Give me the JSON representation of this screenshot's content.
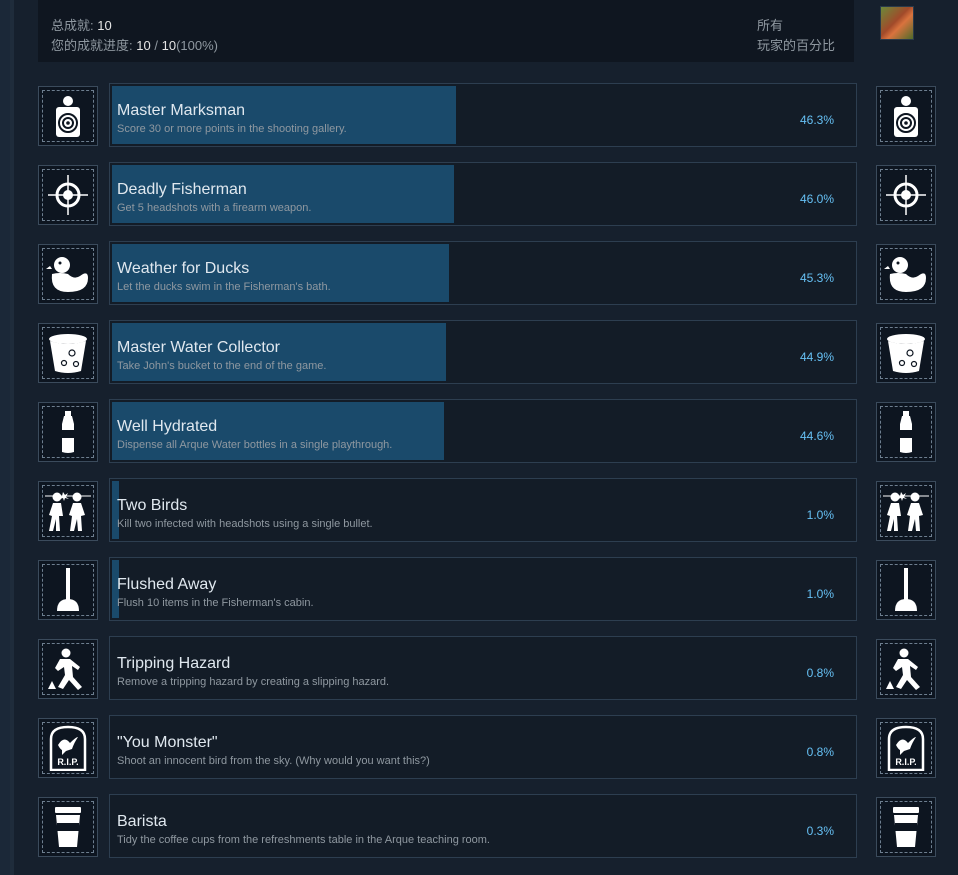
{
  "summary": {
    "total_label": "总成就:",
    "total_value": "10",
    "progress_label": "您的成就进度:",
    "progress_done": "10",
    "progress_sep": "/",
    "progress_total": "10",
    "progress_pct": "(100%)",
    "right_line1": "所有",
    "right_line2": "玩家的百分比"
  },
  "colors": {
    "bar": "#1a4a6b",
    "percent": "#66c0f4",
    "background": "#16202d"
  },
  "achievements": [
    {
      "title": "Master Marksman",
      "desc": "Score 30 or more points in the shooting gallery.",
      "percent": "46.3%",
      "fill": 0.463,
      "icon": "shooting-target-icon"
    },
    {
      "title": "Deadly Fisherman",
      "desc": "Get 5 headshots with a firearm weapon.",
      "percent": "46.0%",
      "fill": 0.46,
      "icon": "crosshair-icon"
    },
    {
      "title": "Weather for Ducks",
      "desc": "Let the ducks swim in the Fisherman's bath.",
      "percent": "45.3%",
      "fill": 0.453,
      "icon": "rubber-duck-icon"
    },
    {
      "title": "Master Water Collector",
      "desc": "Take John's bucket to the end of the game.",
      "percent": "44.9%",
      "fill": 0.449,
      "icon": "bucket-icon"
    },
    {
      "title": "Well Hydrated",
      "desc": "Dispense all Arque Water bottles in a single playthrough.",
      "percent": "44.6%",
      "fill": 0.446,
      "icon": "water-bottle-icon"
    },
    {
      "title": "Two Birds",
      "desc": "Kill two infected with headshots using a single bullet.",
      "percent": "1.0%",
      "fill": 0.01,
      "icon": "two-infected-icon"
    },
    {
      "title": "Flushed Away",
      "desc": "Flush 10 items in the Fisherman's cabin.",
      "percent": "1.0%",
      "fill": 0.01,
      "icon": "plunger-icon"
    },
    {
      "title": "Tripping Hazard",
      "desc": "Remove a tripping hazard by creating a slipping hazard.",
      "percent": "0.8%",
      "fill": 0.0,
      "icon": "slipping-person-icon"
    },
    {
      "title": "\"You Monster\"",
      "desc": "Shoot an innocent bird from the sky. (Why would you want this?)",
      "percent": "0.8%",
      "fill": 0.0,
      "icon": "bird-gravestone-icon",
      "icon_text": "R.I.P."
    },
    {
      "title": "Barista",
      "desc": "Tidy the coffee cups from the refreshments table in the Arque teaching room.",
      "percent": "0.3%",
      "fill": 0.0,
      "icon": "coffee-cup-icon"
    }
  ]
}
